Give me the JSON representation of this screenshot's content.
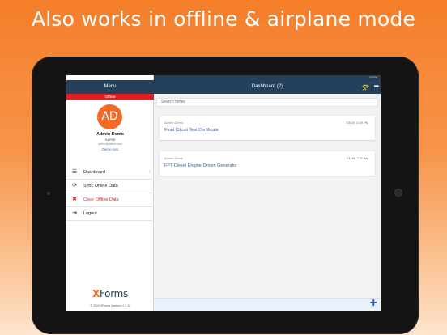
{
  "headline": "Also works in offline & airplane mode",
  "status_bar": {
    "time": "3:00 PM  Thu Jul 4",
    "battery": "100%"
  },
  "sidebar": {
    "title": "Menu",
    "offline_label": "Offline",
    "avatar_initials": "AD",
    "user_name": "Admin Demo",
    "user_role": "Admin",
    "user_email": "admin@demo.com",
    "app_name": "Demo App",
    "items": [
      {
        "label": "Dashboard",
        "icon": "list-icon",
        "glyph": "☰"
      },
      {
        "label": "Sync Offline Data",
        "icon": "sync-icon",
        "glyph": "⟳"
      },
      {
        "label": "Clear Offline Data",
        "icon": "clear-data-icon",
        "glyph": "✖"
      },
      {
        "label": "Logout",
        "icon": "logout-icon",
        "glyph": "⇥"
      }
    ],
    "logo_x": "X",
    "logo_rest": "Forms",
    "copyright": "© 2019 XForms (version: 0.7.1)"
  },
  "main": {
    "title": "Dashboard (2)",
    "search_placeholder": "Search forms",
    "cards": [
      {
        "author": "Admin Demo",
        "date": "7/3/19, 2:19 PM",
        "title": "Final Circuit Test Certificate"
      },
      {
        "author": "Admin Demo",
        "date": "7/1/19, 7:11 AM",
        "title": "FPT-Diesel Engine-Driven Generator"
      }
    ],
    "add_label": "+"
  },
  "colors": {
    "accent": "#f26b26",
    "header": "#25405c",
    "offline": "#e02020",
    "link": "#3a5bbf"
  }
}
